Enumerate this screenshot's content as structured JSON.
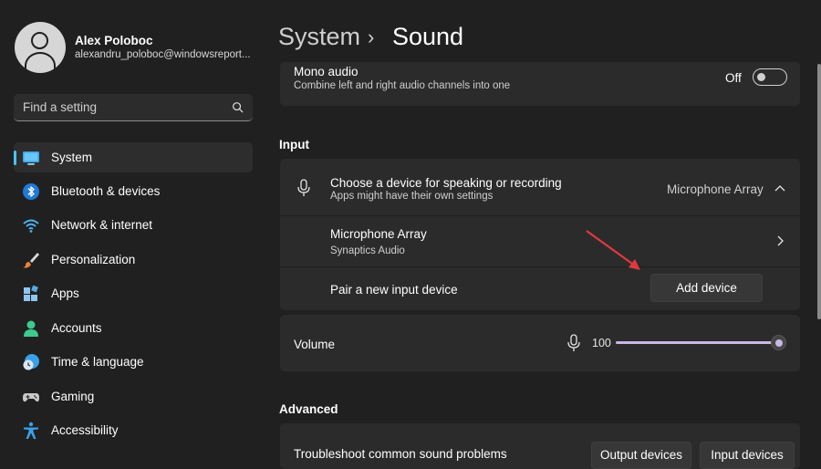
{
  "user": {
    "name": "Alex Poloboc",
    "email": "alexandru_poloboc@windowsreport..."
  },
  "search": {
    "placeholder": "Find a setting",
    "icon": "search-icon"
  },
  "sidebar": {
    "items": [
      {
        "label": "System",
        "icon": "system-monitor-icon",
        "active": true
      },
      {
        "label": "Bluetooth & devices",
        "icon": "bluetooth-icon"
      },
      {
        "label": "Network & internet",
        "icon": "wifi-icon"
      },
      {
        "label": "Personalization",
        "icon": "paintbrush-icon"
      },
      {
        "label": "Apps",
        "icon": "apps-icon"
      },
      {
        "label": "Accounts",
        "icon": "person-icon"
      },
      {
        "label": "Time & language",
        "icon": "clock-globe-icon"
      },
      {
        "label": "Gaming",
        "icon": "gamepad-icon"
      },
      {
        "label": "Accessibility",
        "icon": "accessibility-icon"
      }
    ],
    "accent_color": "#4cc2ff"
  },
  "breadcrumb": {
    "parent": "System",
    "separator": "›",
    "current": "Sound"
  },
  "mono_audio": {
    "title": "Mono audio",
    "subtitle": "Combine left and right audio channels into one",
    "state_label": "Off",
    "enabled": false
  },
  "input": {
    "heading": "Input",
    "chooser": {
      "title": "Choose a device for speaking or recording",
      "subtitle": "Apps might have their own settings",
      "selected": "Microphone Array",
      "expanded": true
    },
    "device": {
      "name": "Microphone Array",
      "driver": "Synaptics Audio"
    },
    "pair": {
      "label": "Pair a new input device",
      "button": "Add device"
    },
    "volume": {
      "label": "Volume",
      "value": "100",
      "level_percent": 100
    }
  },
  "advanced": {
    "heading": "Advanced",
    "troubleshoot": {
      "title": "Troubleshoot common sound problems",
      "output_button": "Output devices",
      "input_button": "Input devices"
    }
  },
  "annotation": {
    "arrow_color": "#e0393e"
  },
  "colors": {
    "background": "#202020",
    "card": "#2b2b2b",
    "slider": "#c8b8e6"
  }
}
